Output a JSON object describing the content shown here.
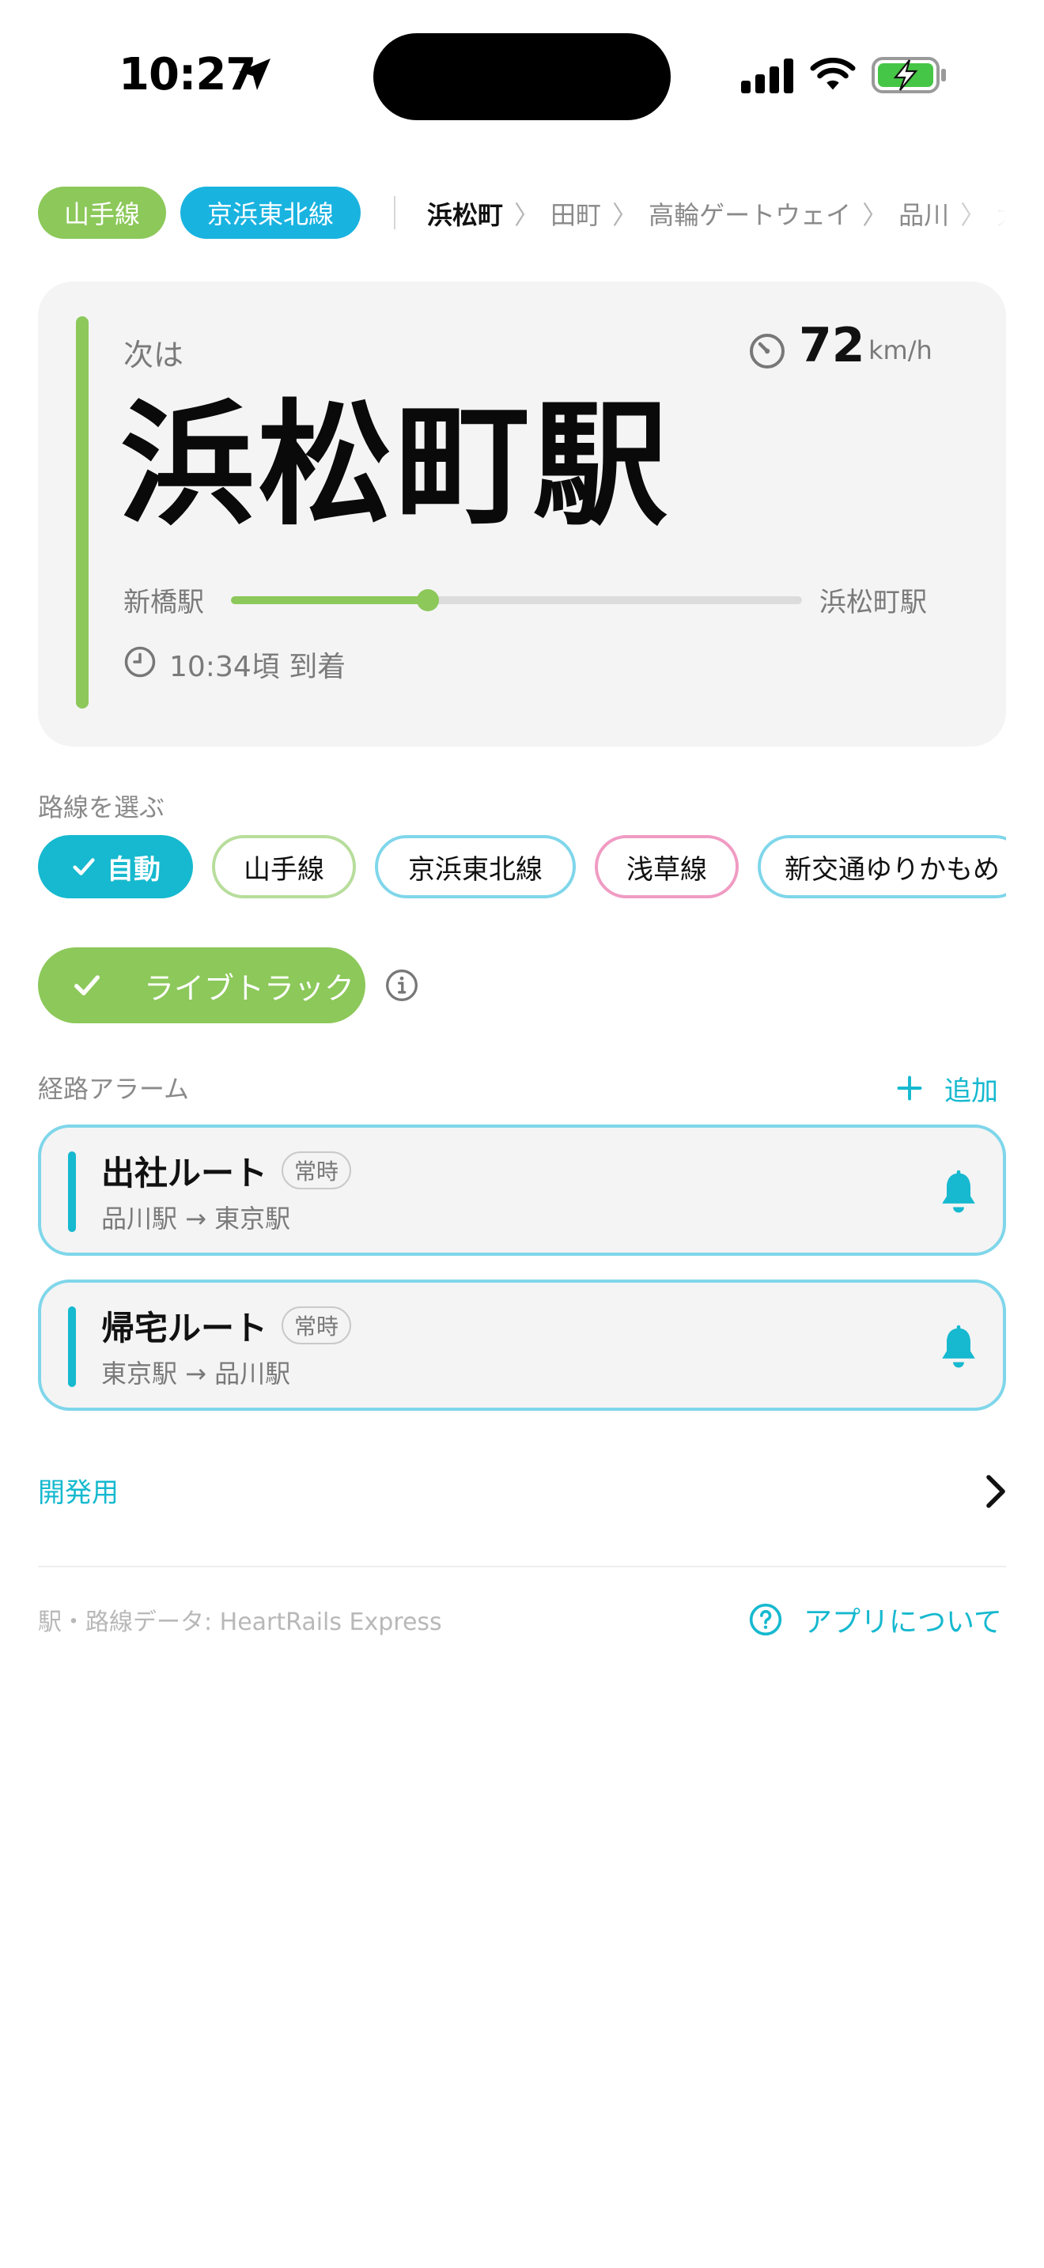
{
  "status_bar": {
    "time": "10:27"
  },
  "line_chips": [
    {
      "label": "山手線",
      "color": "#8cc85a"
    },
    {
      "label": "京浜東北線",
      "color": "#19b3e0"
    }
  ],
  "ticker": {
    "stations": [
      "浜松町",
      "田町",
      "高輪ゲートウェイ",
      "品川",
      "大崎"
    ],
    "separator": "〉"
  },
  "next_station": {
    "label": "次は",
    "name": "浜松町駅",
    "speed_value": "72",
    "speed_unit": "km/h",
    "from": "新橋駅",
    "to": "浜松町駅",
    "progress": 0.345,
    "arrival": "10:34頃 到着",
    "accent": "#8cc85a"
  },
  "route_select": {
    "label": "路線を選ぶ",
    "options": [
      {
        "label": "自動",
        "selected": true
      },
      {
        "label": "山手線",
        "selected": false
      },
      {
        "label": "京浜東北線",
        "selected": false
      },
      {
        "label": "浅草線",
        "selected": false
      },
      {
        "label": "新交通ゆりかもめ",
        "selected": false
      }
    ]
  },
  "live_track": {
    "label": "ライブトラック",
    "enabled": true
  },
  "alarms": {
    "label": "経路アラーム",
    "add_label": "追加",
    "items": [
      {
        "name": "出社ルート",
        "badge": "常時",
        "route": "品川駅 → 東京駅"
      },
      {
        "name": "帰宅ルート",
        "badge": "常時",
        "route": "東京駅 → 品川駅"
      }
    ]
  },
  "dev": {
    "label": "開発用"
  },
  "footer": {
    "credit": "駅・路線データ: HeartRails Express",
    "about_label": "アプリについて"
  },
  "colors": {
    "teal": "#16b9cf",
    "green": "#8cc85a",
    "blue": "#19b3e0",
    "pink": "#f09bc3"
  }
}
